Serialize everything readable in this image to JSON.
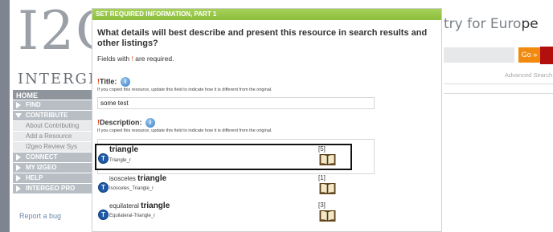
{
  "background": {
    "logo_text": "I2G",
    "brand_text": "INTERGE",
    "nav": {
      "home": "HOME",
      "items": [
        {
          "label": "FIND",
          "icon": "triangle-right-icon"
        },
        {
          "label": "CONTRIBUTE",
          "icon": "triangle-down-icon"
        }
      ],
      "contribute_sub": [
        "About Contributing",
        "Add a Resource",
        "I2geo Review Sys"
      ],
      "items_after": [
        {
          "label": "CONNECT",
          "icon": "triangle-right-icon"
        },
        {
          "label": "MY I2GEO",
          "icon": "triangle-right-icon"
        },
        {
          "label": "HELP",
          "icon": "triangle-right-icon"
        },
        {
          "label": "INTERGEO PRO",
          "icon": "triangle-right-icon"
        }
      ]
    },
    "report_bug": "Report a bug",
    "tagline": "try for Euro",
    "tagline_end": "pe",
    "go_button": "Go »",
    "advanced_search": "Advanced Search"
  },
  "dialog": {
    "header": "SET REQUIRED INFORMATION, PART 1",
    "question": "What details will best describe and present this resource in search results and other listings?",
    "required_note_prefix": "Fields with ",
    "required_note_mark": "!",
    "required_note_suffix": " are required.",
    "title_field": {
      "mark": "!",
      "label": "Title:",
      "hint": "If you copied this resource, update this field to indicate how it is different from the original.",
      "value": "some test"
    },
    "description_field": {
      "mark": "!",
      "label": "Description:",
      "hint": "If you copied this resource, update this field to indicate how it is different from the original.",
      "value": ""
    }
  },
  "autocomplete": {
    "items": [
      {
        "prefix": "",
        "bold": "triangle",
        "sub": "Triangle_r",
        "count": "[5]",
        "selected": true
      },
      {
        "prefix": "isosceles ",
        "bold": "triangle",
        "sub": "Isosceles_Triangle_r",
        "count": "[1]",
        "selected": false
      },
      {
        "prefix": "equilateral ",
        "bold": "triangle",
        "sub": "Equilateral-Triangle_r",
        "count": "[3]",
        "selected": false
      }
    ],
    "badge_letter": "T"
  },
  "colors": {
    "dialog_header": "#8cbe3b",
    "go_button": "#f18a0e",
    "accent_red": "#b20f0f",
    "required_mark": "#d94a1e",
    "badge": "#1f5aa8"
  }
}
